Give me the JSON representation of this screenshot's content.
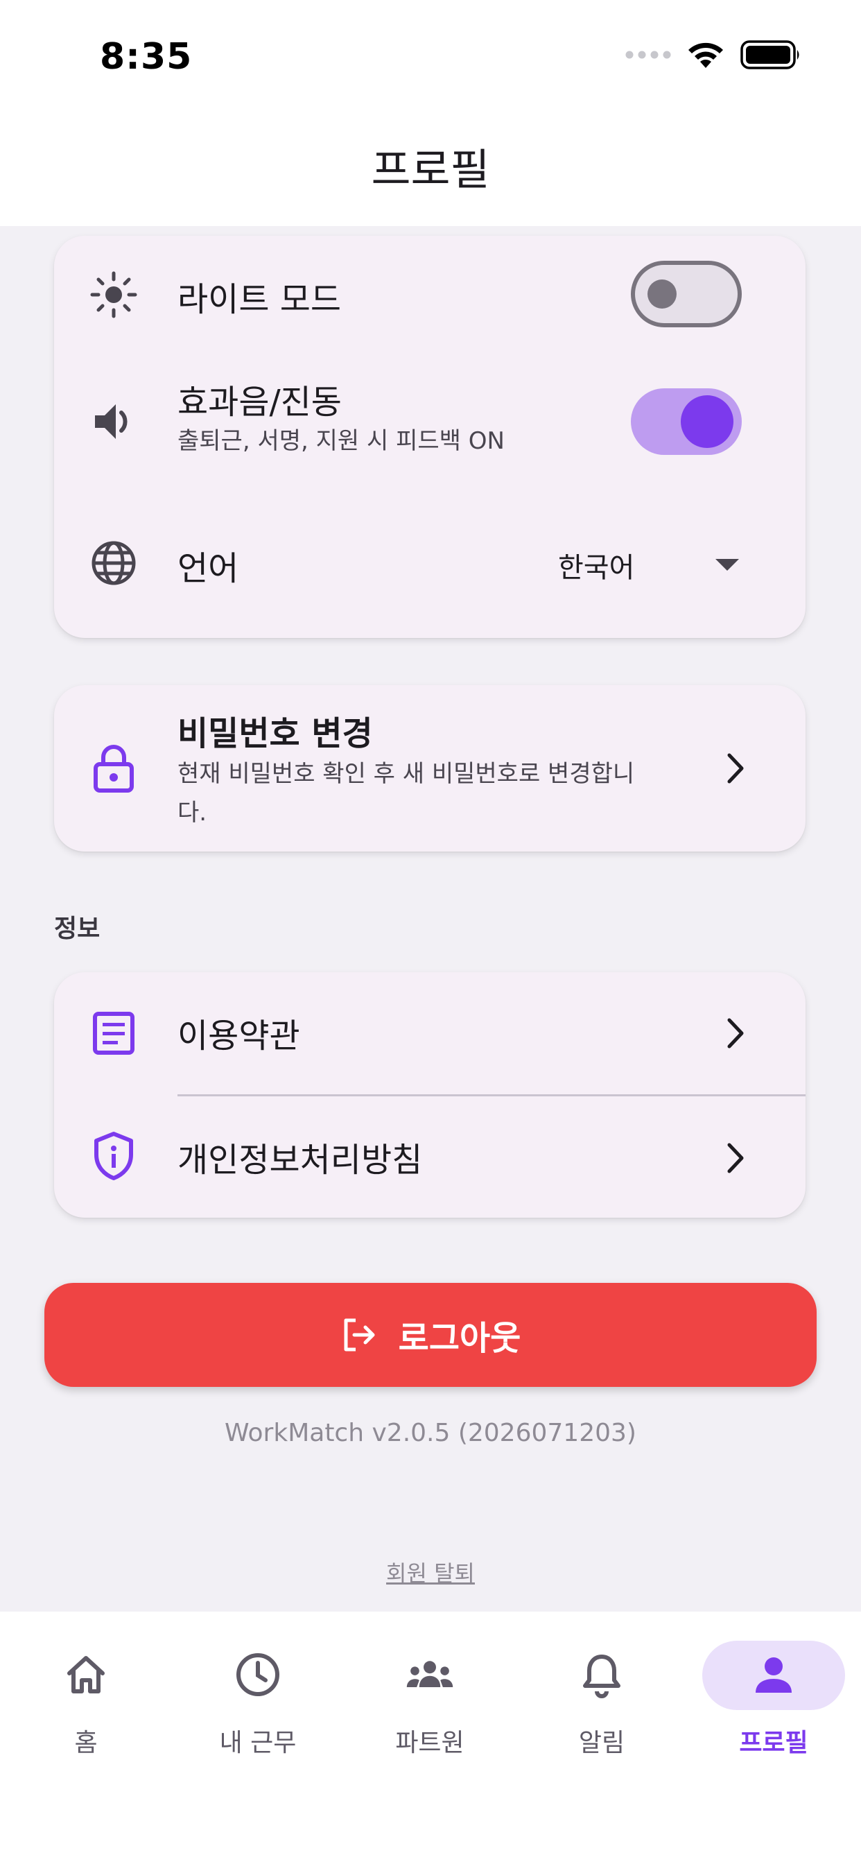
{
  "status_bar": {
    "time": "8:35"
  },
  "app_bar": {
    "title": "프로필"
  },
  "settings": {
    "light_mode": {
      "label": "라이트 모드",
      "enabled": false
    },
    "sound_vibration": {
      "label": "효과음/진동",
      "description": "출퇴근, 서명, 지원 시 피드백 ON",
      "enabled": true
    },
    "language": {
      "label": "언어",
      "selected": "한국어"
    }
  },
  "password": {
    "title": "비밀번호 변경",
    "description_line1": "현재 비밀번호 확인 후 새 비밀번호로 변경합니",
    "description_line2": "다."
  },
  "info_section": {
    "header": "정보",
    "items": [
      {
        "label": "이용약관",
        "icon": "document-icon"
      },
      {
        "label": "개인정보처리방침",
        "icon": "privacy-shield-icon"
      }
    ]
  },
  "logout": {
    "label": "로그아웃"
  },
  "version_text": "WorkMatch v2.0.5 (2026071203)",
  "withdraw_label": "회원 탈퇴",
  "bottom_nav": {
    "items": [
      {
        "label": "홈",
        "icon": "home-icon",
        "active": false
      },
      {
        "label": "내 근무",
        "icon": "clock-icon",
        "active": false
      },
      {
        "label": "파트원",
        "icon": "people-icon",
        "active": false
      },
      {
        "label": "알림",
        "icon": "bell-icon",
        "active": false
      },
      {
        "label": "프로필",
        "icon": "person-icon",
        "active": true
      }
    ]
  },
  "colors": {
    "accent": "#7C3AED",
    "danger": "#EF4444",
    "card": "#F6EFF7",
    "background": "#F2F0F5"
  }
}
